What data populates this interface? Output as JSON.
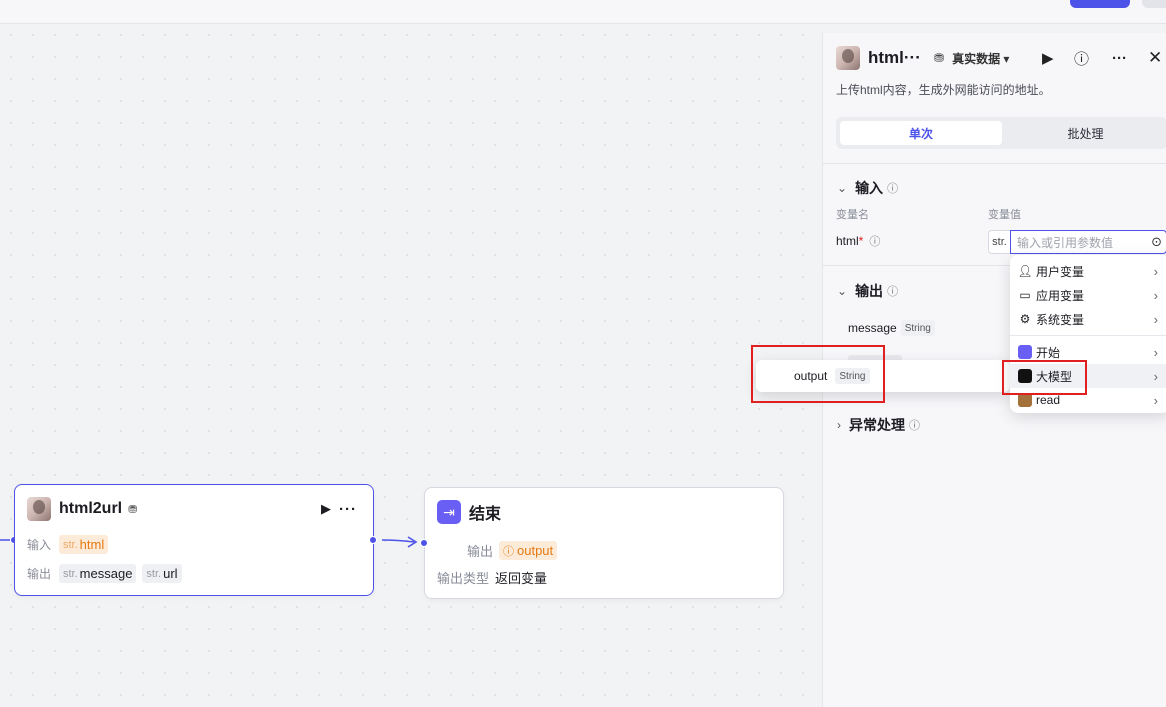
{
  "canvas": {
    "html2url_node": {
      "title": "html2url",
      "input_label": "输入",
      "input_tag": {
        "prefix": "str.",
        "name": "html"
      },
      "output_label": "输出",
      "output_tags": [
        {
          "prefix": "str.",
          "name": "message"
        },
        {
          "prefix": "str.",
          "name": "url"
        }
      ]
    },
    "end_node": {
      "title": "结束",
      "output_label": "输出",
      "output_tag": "output",
      "output_type_label": "输出类型",
      "output_type_value": "返回变量"
    }
  },
  "panel": {
    "title": "html···",
    "data_mode": "真实数据",
    "description": "上传html内容，生成外网能访问的地址。",
    "tabs": [
      {
        "label": "单次",
        "active": true
      },
      {
        "label": "批处理",
        "active": false
      }
    ],
    "input_section": {
      "title": "输入",
      "col_name": "变量名",
      "col_value": "变量值",
      "param_name": "html",
      "required_mark": "*",
      "type_prefix": "str.",
      "value_placeholder": "输入或引用参数值"
    },
    "output_section": {
      "title": "输出",
      "fields": [
        {
          "name": "message",
          "type": "String"
        }
      ]
    },
    "exception_section": {
      "title": "异常处理"
    }
  },
  "dropdown": {
    "items": [
      {
        "label": "用户变量",
        "icon": "user-icon"
      },
      {
        "label": "应用变量",
        "icon": "folder-icon"
      },
      {
        "label": "系统变量",
        "icon": "gear-icon"
      },
      {
        "label": "开始",
        "icon": "start-node-icon"
      },
      {
        "label": "大模型",
        "icon": "llm-node-icon",
        "highlighted": true
      },
      {
        "label": "read",
        "icon": "read-node-icon"
      }
    ]
  },
  "submenu": {
    "item": {
      "name": "output",
      "type": "String"
    }
  },
  "colors": {
    "accent": "#4d53e8",
    "warn_tag_bg": "#fdebd9",
    "warn_tag_text": "#e57a14",
    "highlight_box": "#e02020"
  }
}
